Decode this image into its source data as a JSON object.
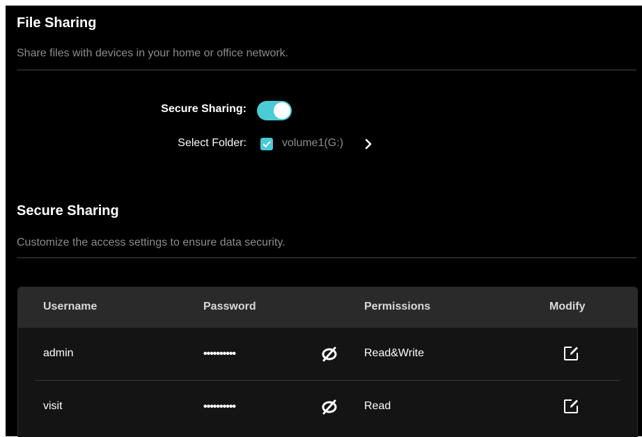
{
  "colors": {
    "accent": "#4acbd6",
    "background": "#000000",
    "muted_text": "#8c8c8c",
    "table_header_bg": "#2a2a2a"
  },
  "file_sharing": {
    "title": "File Sharing",
    "description": "Share files with devices in your home or office network.",
    "secure_sharing_label": "Secure Sharing:",
    "secure_sharing_enabled": true,
    "select_folder_label": "Select Folder:",
    "folder_checked": true,
    "folder_name": "volume1(G:)"
  },
  "secure_sharing": {
    "title": "Secure Sharing",
    "description": "Customize the access settings to ensure data security."
  },
  "table": {
    "headers": {
      "username": "Username",
      "password": "Password",
      "permissions": "Permissions",
      "modify": "Modify"
    },
    "rows": [
      {
        "username": "admin",
        "password": "••••••••••",
        "permissions": "Read&Write"
      },
      {
        "username": "visit",
        "password": "••••••••••",
        "permissions": "Read"
      }
    ]
  },
  "icons": {
    "toggle": "toggle-on",
    "checkbox": "checkmark-icon",
    "chevron": "chevron-right-icon",
    "password_visibility": "eye-hidden-icon",
    "modify": "edit-icon"
  }
}
